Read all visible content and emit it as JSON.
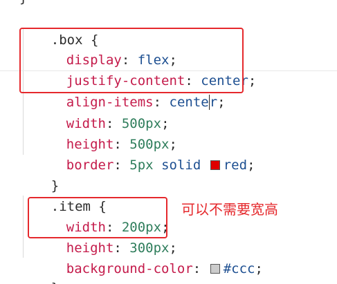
{
  "colors": {
    "property": "#c41a4a",
    "keyword_value": "#1d4f91",
    "number_value": "#2e7d5b",
    "highlight_box": "#e5282c",
    "red_swatch": "#e00000",
    "grey_swatch": "#cccccc"
  },
  "code": {
    "top_cut_brace": "}",
    "box_selector": ".box",
    "box_open": " {",
    "display_prop": "display",
    "display_val": "flex",
    "justify_prop": "justify-content",
    "justify_val": "center",
    "align_prop": "align-items",
    "align_val_before_caret": "cente",
    "align_val_after_caret": "r",
    "width_prop": "width",
    "width_val": "500px",
    "height_prop": "height",
    "height_val": "500px",
    "border_prop": "border",
    "border_val_1": "5px",
    "border_val_2": "solid",
    "border_val_3": "red",
    "box_close": "}",
    "item_selector": ".item",
    "item_open": " {",
    "item_width_prop": "width",
    "item_width_val": "200px",
    "item_height_prop": "height",
    "item_height_val": "300px",
    "bg_prop": "background-color",
    "bg_val": "#ccc",
    "item_close": "}",
    "bottom_cut": "."
  },
  "annotation": {
    "note": "可以不需要宽高"
  },
  "icons": [
    "color-swatch-red-icon",
    "color-swatch-grey-icon"
  ]
}
